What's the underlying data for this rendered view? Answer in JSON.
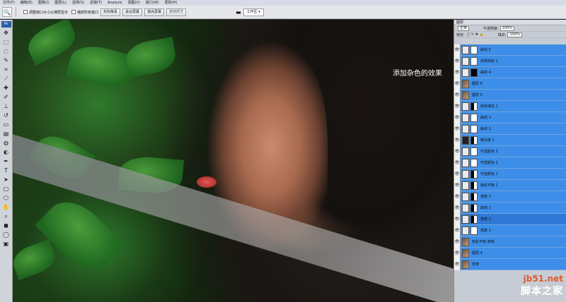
{
  "menubar": {
    "items": [
      "文件(F)",
      "编辑(E)",
      "图像(I)",
      "图层(L)",
      "选择(S)",
      "滤镜(T)",
      "Analysis",
      "视图(V)",
      "窗口(W)",
      "帮助(H)"
    ]
  },
  "options": {
    "resize_windows": "调整窗口大小以满屏显示",
    "zoom_all": "缩放所有窗口",
    "actual_pixels": "实际像素",
    "fit_screen": "适合屏幕",
    "fill_screen": "填充屏幕",
    "print_size": "打印尺寸",
    "workspace_label": "工作区 ▾"
  },
  "toolbox": {
    "badge": "Ps"
  },
  "canvas": {
    "caption": "添加杂色的效果"
  },
  "layers_panel": {
    "tab": "图层",
    "blend_mode": "正常",
    "opacity_label": "不透明度:",
    "opacity_value": "100%",
    "lock_label": "锁定:",
    "fill_label": "填充:",
    "fill_value": "100%",
    "layers": [
      {
        "name": "曲线 5",
        "thumb": "light",
        "mask": "white",
        "selected": false
      },
      {
        "name": "渐变映射 1",
        "thumb": "light",
        "mask": "white",
        "selected": false
      },
      {
        "name": "曲线 4",
        "thumb": "light",
        "mask": "black",
        "selected": false
      },
      {
        "name": "图层 6",
        "thumb": "img",
        "mask": "",
        "selected": false
      },
      {
        "name": "图层 5",
        "thumb": "img",
        "mask": "",
        "selected": false
      },
      {
        "name": "颜色填充 1",
        "thumb": "light",
        "mask": "mix",
        "selected": false
      },
      {
        "name": "曲线 3",
        "thumb": "light",
        "mask": "white",
        "selected": false
      },
      {
        "name": "曲线 2",
        "thumb": "light",
        "mask": "white",
        "selected": false
      },
      {
        "name": "曝光度 1",
        "thumb": "dark",
        "mask": "mix",
        "selected": false
      },
      {
        "name": "可选颜色 3",
        "thumb": "light",
        "mask": "white",
        "selected": false
      },
      {
        "name": "可选颜色 2",
        "thumb": "light",
        "mask": "white",
        "selected": false
      },
      {
        "name": "可选颜色 1",
        "thumb": "light",
        "mask": "mix",
        "selected": false
      },
      {
        "name": "色彩平衡 1",
        "thumb": "light",
        "mask": "mix",
        "selected": false
      },
      {
        "name": "亮度 3",
        "thumb": "light",
        "mask": "mix",
        "selected": false
      },
      {
        "name": "曲线 1",
        "thumb": "light",
        "mask": "mix",
        "selected": false
      },
      {
        "name": "亮度 2",
        "thumb": "light",
        "mask": "mix",
        "selected": true
      },
      {
        "name": "亮度 1",
        "thumb": "light",
        "mask": "white",
        "selected": false
      },
      {
        "name": "色彩平衡 复制",
        "thumb": "img",
        "mask": "",
        "selected": false
      },
      {
        "name": "图层 4",
        "thumb": "img",
        "mask": "",
        "selected": false
      },
      {
        "name": "背景",
        "thumb": "img",
        "mask": "",
        "selected": false
      }
    ]
  },
  "watermark": {
    "domain": "jb51.net",
    "site_name": "脚本之家"
  },
  "colors": {
    "layer_blue": "#3c8ee8",
    "panel_gray": "#c7ccd4",
    "watermark_orange": "#e05a2a"
  }
}
